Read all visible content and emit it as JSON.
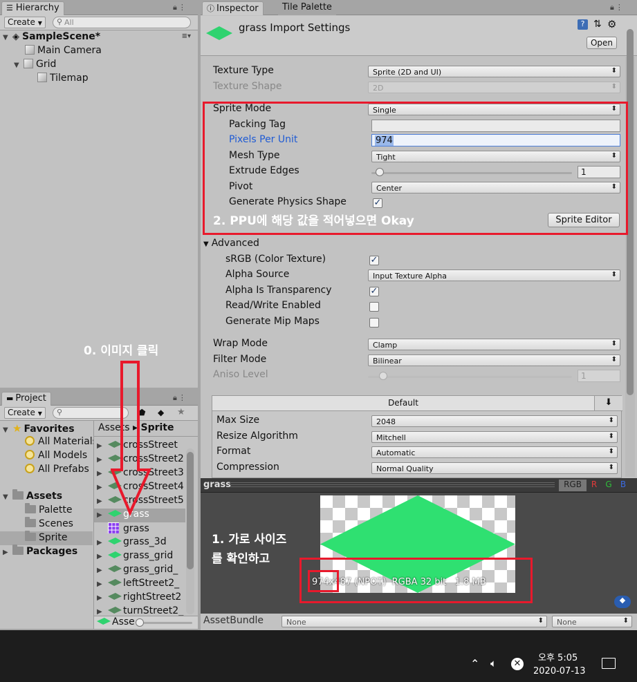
{
  "hierarchy": {
    "tab": "Hierarchy",
    "create": "Create",
    "search_placeholder": "All",
    "scene": "SampleScene*",
    "items": [
      "Main Camera",
      "Grid",
      "Tilemap"
    ]
  },
  "project": {
    "tab": "Project",
    "create": "Create",
    "favorites": "Favorites",
    "fav_items": [
      "All Materials",
      "All Models",
      "All Prefabs"
    ],
    "assets": "Assets",
    "asset_folders": [
      "Palette",
      "Scenes",
      "Sprite"
    ],
    "packages": "Packages",
    "crumb_root": "Assets",
    "crumb_sep": "▸",
    "crumb_leaf": "Sprite",
    "files": [
      "crossStreet",
      "crossStreet2",
      "crossStreet3",
      "crossStreet4",
      "crossStreet5",
      "grass",
      "grass",
      "grass_3d",
      "grass_grid",
      "grass_grid_",
      "leftStreet2_",
      "rightStreet2",
      "turnStreet2_"
    ],
    "footer": "Asse"
  },
  "inspector": {
    "tab": "Inspector",
    "tab2": "Tile Palette",
    "title": "grass Import Settings",
    "open": "Open",
    "rows": {
      "texture_type": "Texture Type",
      "texture_type_val": "Sprite (2D and UI)",
      "texture_shape": "Texture Shape",
      "texture_shape_val": "2D",
      "sprite_mode": "Sprite Mode",
      "sprite_mode_val": "Single",
      "packing_tag": "Packing Tag",
      "ppu": "Pixels Per Unit",
      "ppu_val": "974",
      "mesh_type": "Mesh Type",
      "mesh_type_val": "Tight",
      "extrude": "Extrude Edges",
      "extrude_val": "1",
      "pivot": "Pivot",
      "pivot_val": "Center",
      "gen_physics": "Generate Physics Shape",
      "sprite_editor": "Sprite Editor",
      "advanced": "Advanced",
      "srgb": "sRGB (Color Texture)",
      "alpha_source": "Alpha Source",
      "alpha_source_val": "Input Texture Alpha",
      "alpha_transp": "Alpha Is Transparency",
      "readwrite": "Read/Write Enabled",
      "mipmaps": "Generate Mip Maps",
      "wrap": "Wrap Mode",
      "wrap_val": "Clamp",
      "filter": "Filter Mode",
      "filter_val": "Bilinear",
      "aniso": "Aniso Level",
      "aniso_val": "1",
      "platform": "Default",
      "max_size": "Max Size",
      "max_size_val": "2048",
      "resize": "Resize Algorithm",
      "resize_val": "Mitchell",
      "format": "Format",
      "format_val": "Automatic",
      "compression": "Compression",
      "compression_val": "Normal Quality"
    }
  },
  "preview": {
    "title": "grass",
    "channels": [
      "RGB",
      "R",
      "G",
      "B"
    ],
    "channel_colors": [
      "#222",
      "#e23a3a",
      "#2fbf3a",
      "#3a6ae2"
    ],
    "info": "974x487 (NPOT)  RGBA 32 bit   1.8 MB",
    "assetbundle": "AssetBundle",
    "bundle_a": "None",
    "bundle_b": "None"
  },
  "annotations": {
    "a0": "0. 이미지 클릭",
    "a1_line1": "1. 가로 사이즈",
    "a1_line2": "를 확인하고",
    "a2": "2. PPU에 해당 값을 적어넣으면 Okay"
  },
  "taskbar": {
    "time": "오후 5:05",
    "date": "2020-07-13"
  },
  "colors": {
    "accent_red": "#e8192c",
    "ppu_blue": "#1f5bd4",
    "tile_green": "#2fd36f",
    "taskbar_bg": "#1d1d1d"
  }
}
